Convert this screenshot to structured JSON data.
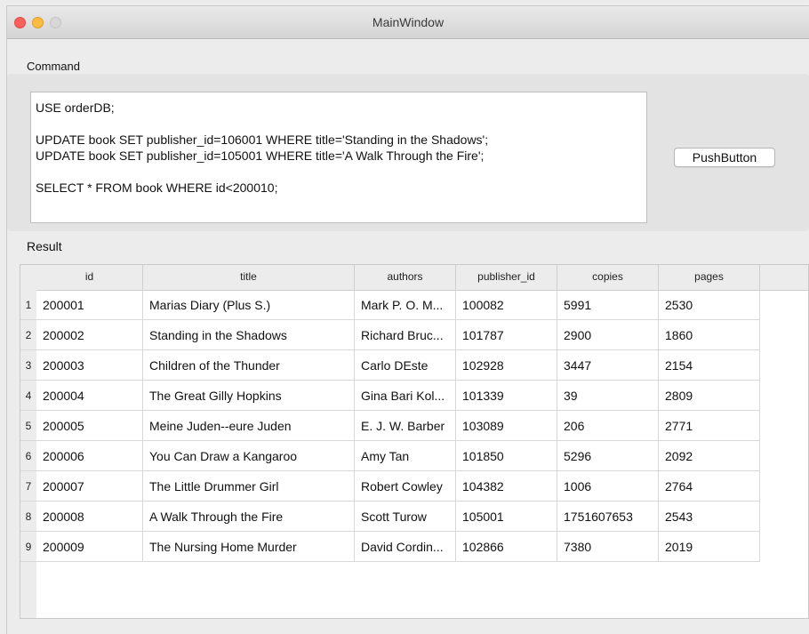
{
  "window": {
    "title": "MainWindow"
  },
  "command": {
    "label": "Command",
    "lines": [
      "USE orderDB;",
      "",
      "UPDATE book SET publisher_id=106001 WHERE title='Standing in the Shadows';",
      "UPDATE book SET publisher_id=105001 WHERE title='A Walk Through the Fire';",
      "",
      "SELECT * FROM book WHERE id<200010;"
    ],
    "button_label": "PushButton"
  },
  "result": {
    "label": "Result",
    "columns": [
      "id",
      "title",
      "authors",
      "publisher_id",
      "copies",
      "pages"
    ],
    "rows": [
      {
        "num": "1",
        "id": "200001",
        "title": "Marias Diary (Plus S.)",
        "authors": "Mark P. O. M...",
        "publisher_id": "100082",
        "copies": "5991",
        "pages": "2530"
      },
      {
        "num": "2",
        "id": "200002",
        "title": "Standing in the Shadows",
        "authors": "Richard Bruc...",
        "publisher_id": "101787",
        "copies": "2900",
        "pages": "1860"
      },
      {
        "num": "3",
        "id": "200003",
        "title": "Children of the Thunder",
        "authors": "Carlo DEste",
        "publisher_id": "102928",
        "copies": "3447",
        "pages": "2154"
      },
      {
        "num": "4",
        "id": "200004",
        "title": "The Great Gilly Hopkins",
        "authors": "Gina Bari Kol...",
        "publisher_id": "101339",
        "copies": "39",
        "pages": "2809"
      },
      {
        "num": "5",
        "id": "200005",
        "title": "Meine Juden--eure Juden",
        "authors": "E. J. W. Barber",
        "publisher_id": "103089",
        "copies": "206",
        "pages": "2771"
      },
      {
        "num": "6",
        "id": "200006",
        "title": "You Can Draw a Kangaroo",
        "authors": "Amy Tan",
        "publisher_id": "101850",
        "copies": "5296",
        "pages": "2092"
      },
      {
        "num": "7",
        "id": "200007",
        "title": "The Little Drummer Girl",
        "authors": "Robert Cowley",
        "publisher_id": "104382",
        "copies": "1006",
        "pages": "2764"
      },
      {
        "num": "8",
        "id": "200008",
        "title": "A Walk Through the Fire",
        "authors": "Scott Turow",
        "publisher_id": "105001",
        "copies": "1751607653",
        "pages": "2543"
      },
      {
        "num": "9",
        "id": "200009",
        "title": "The Nursing Home Murder",
        "authors": "David Cordin...",
        "publisher_id": "102866",
        "copies": "7380",
        "pages": "2019"
      }
    ]
  }
}
